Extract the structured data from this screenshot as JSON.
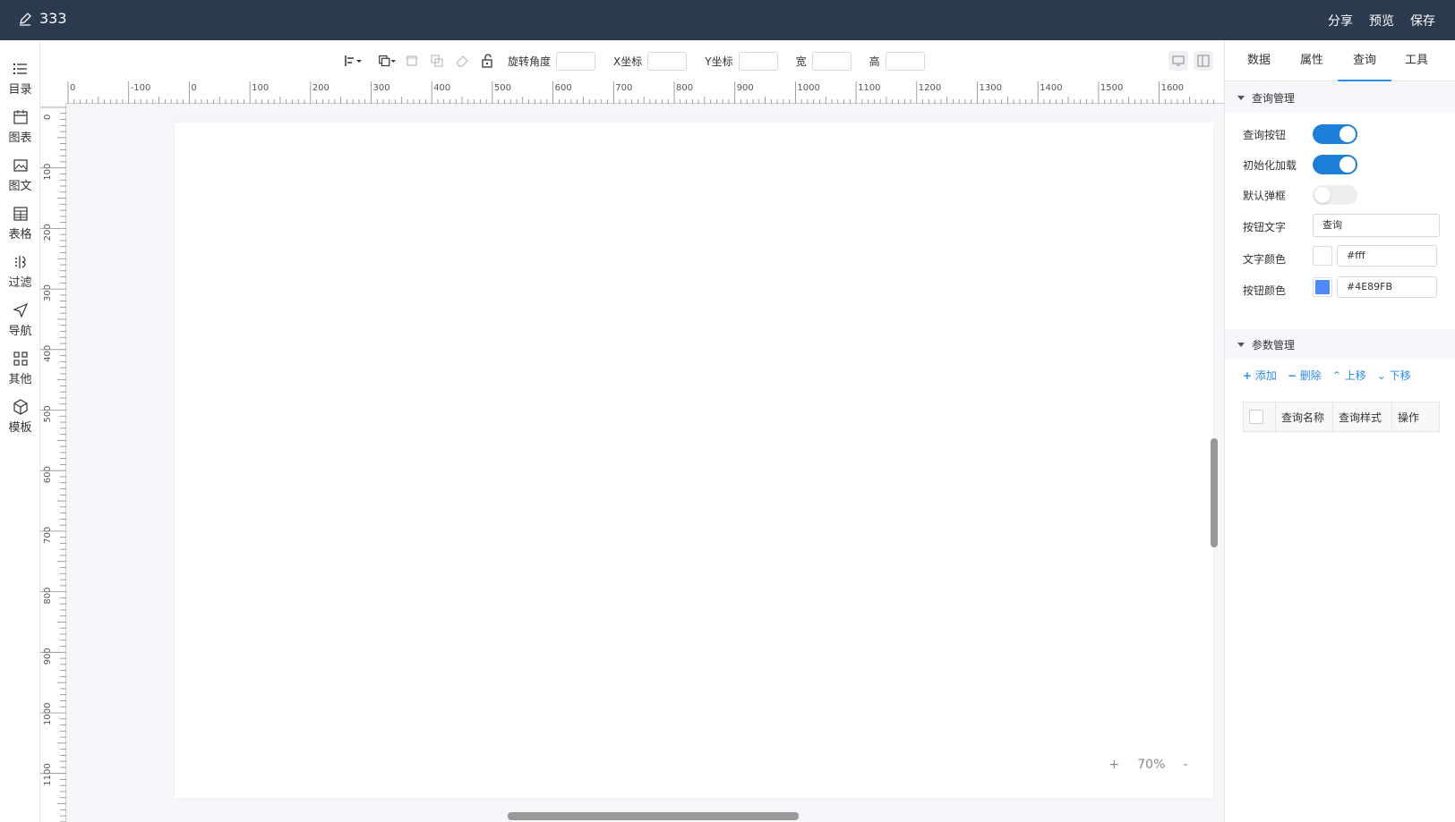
{
  "header": {
    "title": "333",
    "actions": [
      "分享",
      "预览",
      "保存"
    ]
  },
  "sidebar": {
    "items": [
      {
        "label": "目录",
        "icon": "list-icon"
      },
      {
        "label": "图表",
        "icon": "calendar-chart-icon"
      },
      {
        "label": "图文",
        "icon": "image-text-icon"
      },
      {
        "label": "表格",
        "icon": "table-icon"
      },
      {
        "label": "过滤",
        "icon": "filter-icon"
      },
      {
        "label": "导航",
        "icon": "navigation-icon"
      },
      {
        "label": "其他",
        "icon": "grid-icon"
      },
      {
        "label": "模板",
        "icon": "template-icon"
      }
    ]
  },
  "toolbar": {
    "rotate_label": "旋转角度",
    "x_label": "X坐标",
    "y_label": "Y坐标",
    "width_label": "宽",
    "height_label": "高",
    "rotate_value": "",
    "x_value": "",
    "y_value": "",
    "width_value": "",
    "height_value": ""
  },
  "ruler": {
    "h_labels": [
      "0",
      "-100",
      "0",
      "100",
      "200",
      "300",
      "400",
      "500",
      "600",
      "700",
      "800",
      "900",
      "1000",
      "1100",
      "1200",
      "1300",
      "1400",
      "1500",
      "1600"
    ],
    "v_labels": [
      "0",
      "100",
      "200",
      "300",
      "400",
      "500",
      "600",
      "700",
      "800",
      "900",
      "1000",
      "1100"
    ]
  },
  "zoom": {
    "plus": "+",
    "value": "70%",
    "minus": "-"
  },
  "panel": {
    "tabs": [
      "数据",
      "属性",
      "查询",
      "工具"
    ],
    "active_tab": "查询",
    "query_section": {
      "title": "查询管理",
      "query_button_label": "查询按钮",
      "query_button_on": true,
      "init_load_label": "初始化加载",
      "init_load_on": true,
      "default_popup_label": "默认弹框",
      "default_popup_on": false,
      "button_text_label": "按钮文字",
      "button_text_value": "查询",
      "text_color_label": "文字颜色",
      "text_color_value": "#fff",
      "button_color_label": "按钮颜色",
      "button_color_value": "#4E89FB"
    },
    "param_section": {
      "title": "参数管理",
      "actions": [
        "添加",
        "删除",
        "上移",
        "下移"
      ],
      "columns": [
        "查询名称",
        "查询样式",
        "操作"
      ]
    }
  },
  "colors": {
    "topbar": "#2b3a4e",
    "accent": "#2d8cf0",
    "toggle_on": "#1e7fd8",
    "button_color_swatch": "#4E89FB"
  }
}
